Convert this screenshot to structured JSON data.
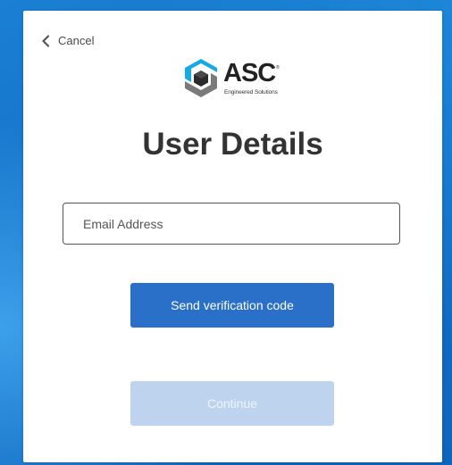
{
  "nav": {
    "cancel_label": "Cancel"
  },
  "logo": {
    "brand": "ASC",
    "tagline": "Engineered Solutions",
    "colors": {
      "cyan": "#16a9e6",
      "gray": "#7a7a7a",
      "dark": "#222222"
    }
  },
  "page": {
    "title": "User Details"
  },
  "form": {
    "email_placeholder": "Email Address",
    "email_value": "",
    "send_code_label": "Send verification code",
    "continue_label": "Continue"
  },
  "theme": {
    "primary_button": "#2a70c8",
    "disabled_button": "#bed4ee",
    "background": "#1776c9",
    "card": "#ffffff"
  },
  "icons": {
    "back": "chevron-left-icon",
    "logo_mark": "hexagon-logo-icon"
  }
}
